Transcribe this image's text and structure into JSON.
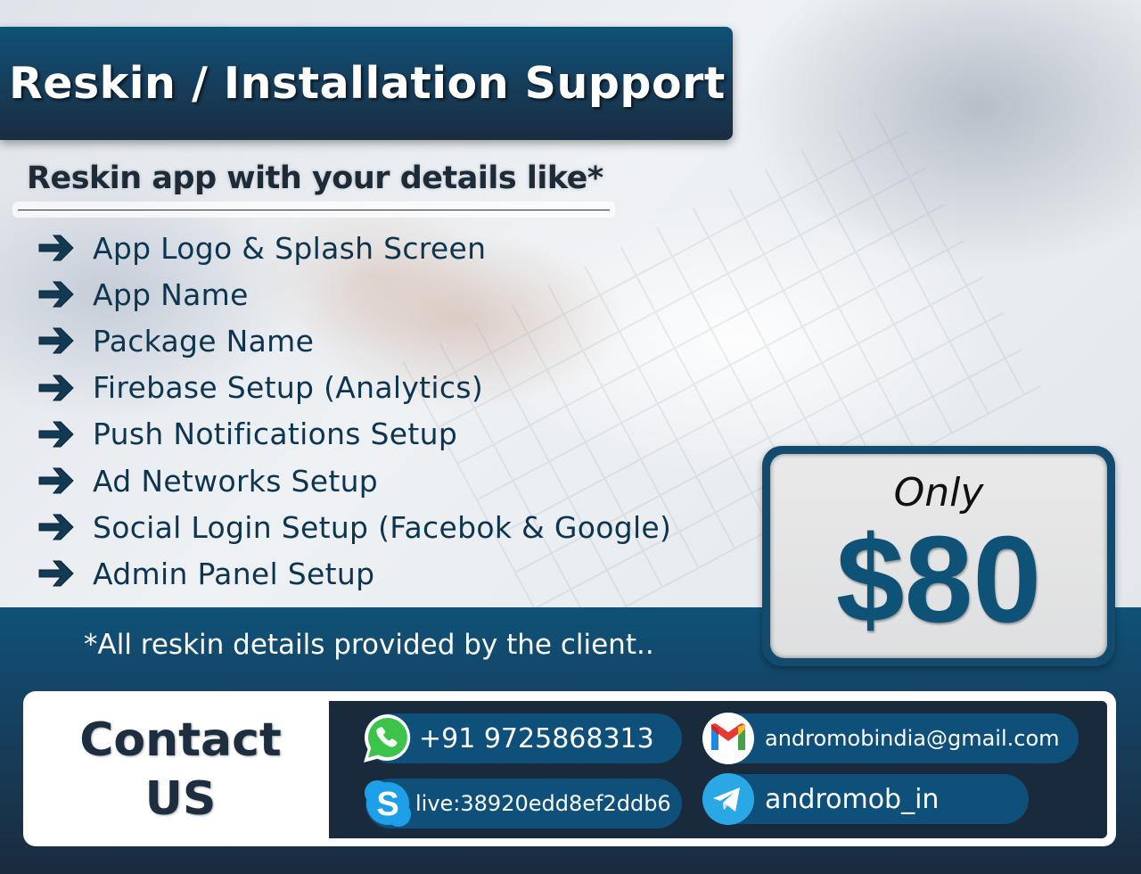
{
  "header": {
    "title": "Reskin / Installation Support",
    "subtitle": "Reskin app with your details like*"
  },
  "features": [
    {
      "label": "App Logo & Splash Screen",
      "icon": "arrow-right-icon"
    },
    {
      "label": "App Name",
      "icon": "arrow-right-icon"
    },
    {
      "label": "Package Name",
      "icon": "arrow-right-icon"
    },
    {
      "label": "Firebase Setup (Analytics)",
      "icon": "arrow-right-icon"
    },
    {
      "label": "Push Notifications Setup",
      "icon": "arrow-right-icon"
    },
    {
      "label": "Ad Networks Setup",
      "icon": "arrow-right-icon"
    },
    {
      "label": "Social Login Setup (Facebok & Google)",
      "icon": "arrow-right-icon"
    },
    {
      "label": "Admin Panel Setup",
      "icon": "arrow-right-icon"
    }
  ],
  "price": {
    "prefix": "Only",
    "amount": "$80"
  },
  "disclaimer": "*All reskin details provided by the client..",
  "contact": {
    "heading_line1": "Contact",
    "heading_line2": "US",
    "whatsapp": {
      "icon": "whatsapp-icon",
      "value": "+91 9725868313"
    },
    "skype": {
      "icon": "skype-icon",
      "value": "live:38920edd8ef2ddb6"
    },
    "email": {
      "icon": "gmail-icon",
      "value": "andromobindia@gmail.com"
    },
    "telegram": {
      "icon": "telegram-icon",
      "value": "andromob_in"
    }
  },
  "colors": {
    "primary_blue": "#0f5278",
    "dark_navy": "#182a3b",
    "text_dark": "#0d3550",
    "whatsapp_green": "#3cc34a",
    "skype_blue": "#1ea0e8",
    "telegram_blue": "#2aa8e6"
  }
}
